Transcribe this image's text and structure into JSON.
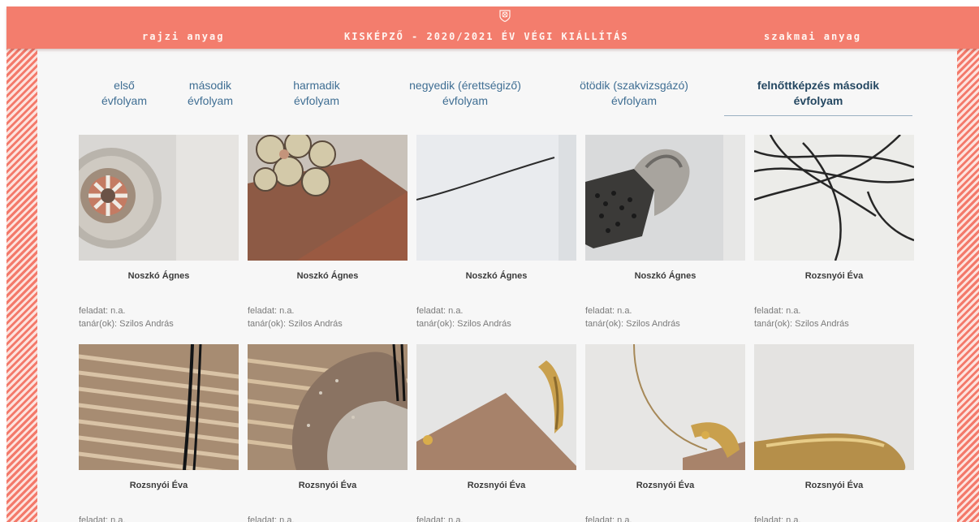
{
  "header": {
    "left_link": "rajzi anyag",
    "title": "KISKÉPZŐ - 2020/2021 ÉV VÉGI KIÁLLÍTÁS",
    "right_link": "szakmai anyag",
    "logo_icon": "crest-icon",
    "color": "#f37d6d"
  },
  "tabs": [
    {
      "line1": "első",
      "line2": "évfolyam"
    },
    {
      "line1": "második",
      "line2": "évfolyam"
    },
    {
      "line1": "harmadik",
      "line2": "évfolyam"
    },
    {
      "line1": "negyedik (érettségiző)",
      "line2": "évfolyam"
    },
    {
      "line1": "ötödik (szakvizsgázó)",
      "line2": "évfolyam"
    },
    {
      "line1": "felnőttképzés második",
      "line2": "évfolyam",
      "active": true
    }
  ],
  "works": [
    {
      "name": "Noszkó Ágnes",
      "task": "feladat: n.a.",
      "teacher": "tanár(ok): Szilos András"
    },
    {
      "name": "Noszkó Ágnes",
      "task": "feladat: n.a.",
      "teacher": "tanár(ok): Szilos András"
    },
    {
      "name": "Noszkó Ágnes",
      "task": "feladat: n.a.",
      "teacher": "tanár(ok): Szilos András"
    },
    {
      "name": "Noszkó Ágnes",
      "task": "feladat: n.a.",
      "teacher": "tanár(ok): Szilos András"
    },
    {
      "name": "Rozsnyói Éva",
      "task": "feladat: n.a.",
      "teacher": "tanár(ok): Szilos András"
    },
    {
      "name": "Rozsnyói Éva",
      "task": "feladat: n.a.",
      "teacher": ""
    },
    {
      "name": "Rozsnyói Éva",
      "task": "feladat: n.a.",
      "teacher": ""
    },
    {
      "name": "Rozsnyói Éva",
      "task": "feladat: n.a.",
      "teacher": ""
    },
    {
      "name": "Rozsnyói Éva",
      "task": "feladat: n.a.",
      "teacher": ""
    },
    {
      "name": "Rozsnyói Éva",
      "task": "feladat: n.a.",
      "teacher": ""
    }
  ]
}
